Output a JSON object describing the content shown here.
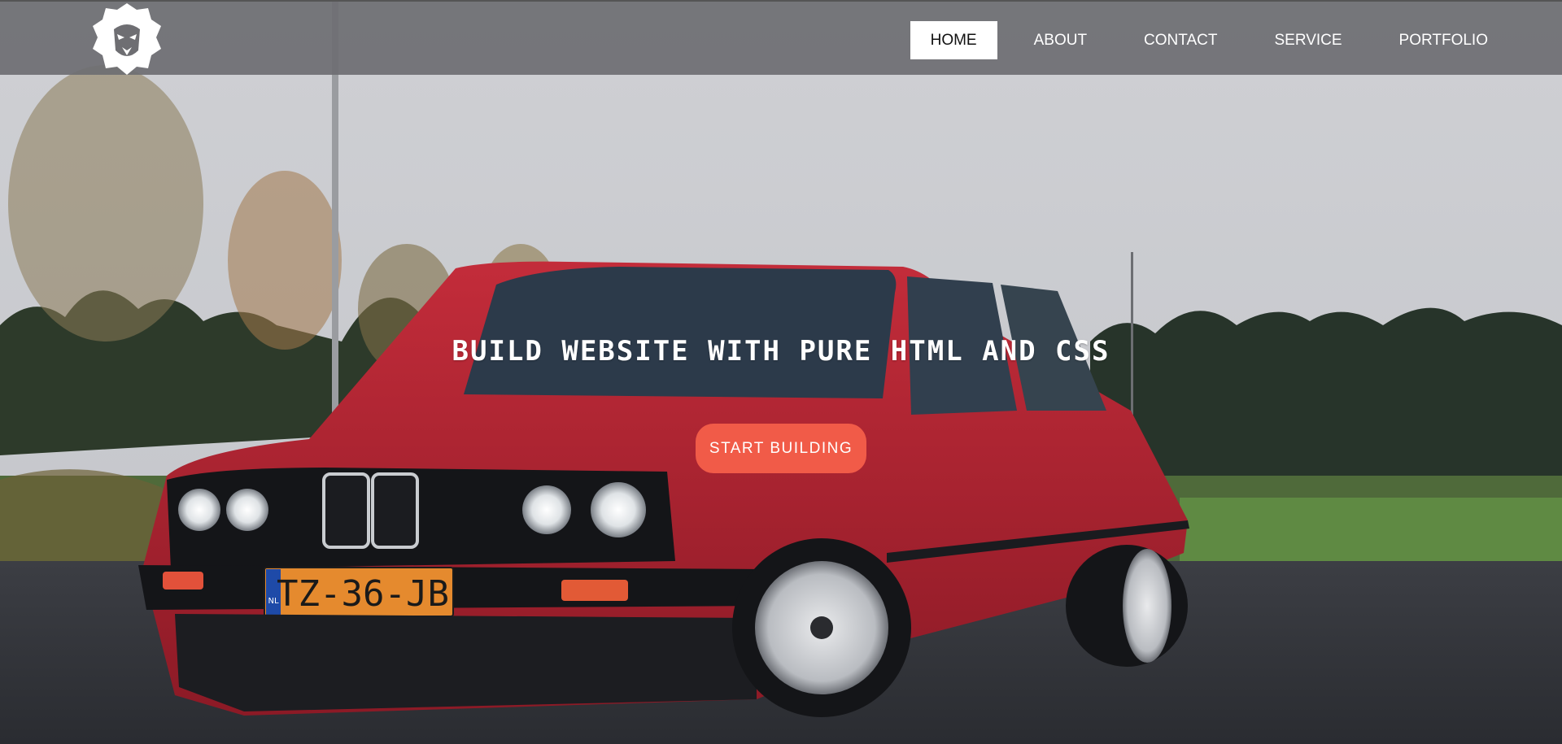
{
  "header": {
    "logo_icon": "lion-head-icon",
    "nav": [
      {
        "label": "HOME",
        "active": true
      },
      {
        "label": "ABOUT",
        "active": false
      },
      {
        "label": "CONTACT",
        "active": false
      },
      {
        "label": "SERVICE",
        "active": false
      },
      {
        "label": "PORTFOLIO",
        "active": false
      }
    ]
  },
  "hero": {
    "headline": "BUILD WEBSITE WITH PURE HTML AND CSS",
    "cta_label": "START BUILDING",
    "plate_text": "TZ-36-JB",
    "plate_country": "NL"
  },
  "colors": {
    "accent": "#f15b48",
    "nav_background": "#6e6e72",
    "car_red": "#b3242f",
    "sky": "#c9cbd0"
  }
}
